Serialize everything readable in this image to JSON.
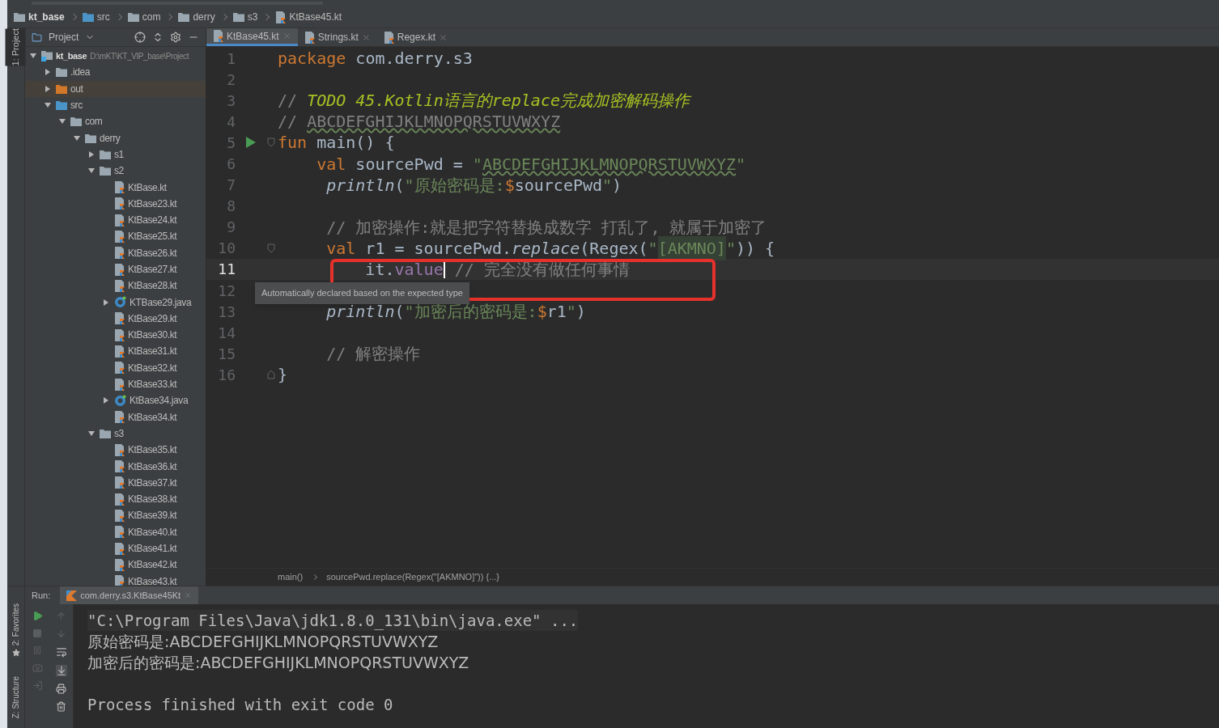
{
  "navbar": {
    "crumbs": [
      "kt_base",
      "src",
      "com",
      "derry",
      "s3",
      "KtBase45.kt"
    ]
  },
  "project_panel": {
    "title": "Project",
    "tool_tabs": [
      "1: Project"
    ]
  },
  "editor_tabs": [
    {
      "label": "KtBase45.kt",
      "selected": true
    },
    {
      "label": "Strings.kt",
      "selected": false
    },
    {
      "label": "Regex.kt",
      "selected": false
    }
  ],
  "tree": [
    {
      "label": "kt_base",
      "kind": "module",
      "path": "D:\\mKT\\KT_VIP_base\\Project",
      "expanded": true,
      "children": [
        {
          "label": ".idea",
          "kind": "folder",
          "expanded": false
        },
        {
          "label": "out",
          "kind": "excluded",
          "expanded": false
        },
        {
          "label": "src",
          "kind": "source",
          "expanded": true,
          "children": [
            {
              "label": "com",
              "kind": "package",
              "expanded": true,
              "children": [
                {
                  "label": "derry",
                  "kind": "package",
                  "expanded": true,
                  "children": [
                    {
                      "label": "s1",
                      "kind": "package",
                      "expanded": false
                    },
                    {
                      "label": "s2",
                      "kind": "package",
                      "expanded": true,
                      "children": [
                        {
                          "label": "KtBase.kt",
                          "kind": "kotlin"
                        },
                        {
                          "label": "KtBase23.kt",
                          "kind": "kotlin"
                        },
                        {
                          "label": "KtBase24.kt",
                          "kind": "kotlin"
                        },
                        {
                          "label": "KtBase25.kt",
                          "kind": "kotlin"
                        },
                        {
                          "label": "KtBase26.kt",
                          "kind": "kotlin"
                        },
                        {
                          "label": "KtBase27.kt",
                          "kind": "kotlin"
                        },
                        {
                          "label": "KtBase28.kt",
                          "kind": "kotlin"
                        },
                        {
                          "label": "KTBase29.java",
                          "kind": "java",
                          "expanded": false
                        },
                        {
                          "label": "KtBase29.kt",
                          "kind": "kotlin"
                        },
                        {
                          "label": "KtBase30.kt",
                          "kind": "kotlin"
                        },
                        {
                          "label": "KtBase31.kt",
                          "kind": "kotlin"
                        },
                        {
                          "label": "KtBase32.kt",
                          "kind": "kotlin"
                        },
                        {
                          "label": "KtBase33.kt",
                          "kind": "kotlin"
                        },
                        {
                          "label": "KtBase34.java",
                          "kind": "java",
                          "expanded": false
                        },
                        {
                          "label": "KtBase34.kt",
                          "kind": "kotlin"
                        }
                      ]
                    },
                    {
                      "label": "s3",
                      "kind": "package",
                      "expanded": true,
                      "children": [
                        {
                          "label": "KtBase35.kt",
                          "kind": "kotlin"
                        },
                        {
                          "label": "KtBase36.kt",
                          "kind": "kotlin"
                        },
                        {
                          "label": "KtBase37.kt",
                          "kind": "kotlin"
                        },
                        {
                          "label": "KtBase38.kt",
                          "kind": "kotlin"
                        },
                        {
                          "label": "KtBase39.kt",
                          "kind": "kotlin"
                        },
                        {
                          "label": "KtBase40.kt",
                          "kind": "kotlin"
                        },
                        {
                          "label": "KtBase41.kt",
                          "kind": "kotlin"
                        },
                        {
                          "label": "KtBase42.kt",
                          "kind": "kotlin"
                        },
                        {
                          "label": "KtBase43.kt",
                          "kind": "kotlin"
                        }
                      ]
                    }
                  ]
                }
              ]
            }
          ]
        }
      ]
    }
  ],
  "code_lines": [
    {
      "number": "1",
      "current": false,
      "tokens": [
        {
          "kind": "keyword",
          "text": "package"
        },
        {
          "kind": "text",
          "text": " com.derry.s3"
        }
      ]
    },
    {
      "number": "2",
      "current": false
    },
    {
      "number": "3",
      "current": false,
      "tokens": [
        {
          "kind": "comment",
          "text": "// "
        },
        {
          "kind": "todo",
          "text": "TODO 45.Kotlin语言的replace完成加密解码操作"
        }
      ]
    },
    {
      "number": "4",
      "current": false,
      "tokens": [
        {
          "kind": "comment",
          "text": "// "
        },
        {
          "kind": "comment_spell",
          "text": "ABCDEFGHIJKLMNOPQRSTUVWXYZ"
        }
      ]
    },
    {
      "number": "5",
      "current": false,
      "kind": "run_fold",
      "tokens": [
        {
          "kind": "keyword",
          "text": "fun"
        },
        {
          "kind": "text",
          "text": " main() {"
        }
      ]
    },
    {
      "number": "6",
      "current": false,
      "tokens": [
        {
          "kind": "keyword",
          "text": "    val"
        },
        {
          "kind": "text",
          "text": " sourcePwd = "
        },
        {
          "kind": "string",
          "text": "\""
        },
        {
          "kind": "string_spell",
          "text": "ABCDEFGHIJKLMNOPQRSTUVWXYZ"
        },
        {
          "kind": "string",
          "text": "\""
        }
      ]
    },
    {
      "number": "7",
      "current": false,
      "tokens": [
        {
          "kind": "call",
          "text": "     println"
        },
        {
          "kind": "text",
          "text": "("
        },
        {
          "kind": "string",
          "text": "\"原始密码是:"
        },
        {
          "kind": "template",
          "text": "$"
        },
        {
          "kind": "text",
          "text": "sourcePwd"
        },
        {
          "kind": "string",
          "text": "\""
        },
        {
          "kind": "text",
          "text": ")"
        }
      ]
    },
    {
      "number": "8",
      "current": false
    },
    {
      "number": "9",
      "current": false,
      "tokens": [
        {
          "kind": "comment",
          "text": "     // 加密操作:就是把字符替换成数字 打乱了, 就属于加密了"
        }
      ]
    },
    {
      "number": "10",
      "current": false,
      "kind": "fold",
      "tokens": [
        {
          "kind": "keyword",
          "text": "     val"
        },
        {
          "kind": "text",
          "text": " r1 = sourcePwd."
        },
        {
          "kind": "call",
          "text": "replace"
        },
        {
          "kind": "text",
          "text": "(Regex("
        },
        {
          "kind": "string",
          "text": "\""
        },
        {
          "kind": "regex",
          "text": "[AKMNO]"
        },
        {
          "kind": "string",
          "text": "\""
        },
        {
          "kind": "text",
          "text": ")) {"
        }
      ]
    },
    {
      "number": "11",
      "current": true,
      "tokens": [
        {
          "kind": "text",
          "text": "         it."
        },
        {
          "kind": "property",
          "text": "value"
        },
        {
          "kind": "caret"
        },
        {
          "kind": "comment",
          "text": " // 完全没有做任何事情"
        }
      ]
    },
    {
      "number": "12",
      "current": false
    },
    {
      "number": "13",
      "current": false,
      "tokens": [
        {
          "kind": "call",
          "text": "     println"
        },
        {
          "kind": "text",
          "text": "("
        },
        {
          "kind": "string",
          "text": "\"加密后的密码是:"
        },
        {
          "kind": "template",
          "text": "$"
        },
        {
          "kind": "text",
          "text": "r1"
        },
        {
          "kind": "string",
          "text": "\""
        },
        {
          "kind": "text",
          "text": ")"
        }
      ]
    },
    {
      "number": "14",
      "current": false
    },
    {
      "number": "15",
      "current": false,
      "tokens": [
        {
          "kind": "comment",
          "text": "     // 解密操作"
        }
      ]
    },
    {
      "number": "16",
      "current": false,
      "kind": "fold_end",
      "tokens": [
        {
          "kind": "text",
          "text": "}"
        }
      ]
    }
  ],
  "tooltip": "Automatically declared based on the expected type",
  "editor_breadcrumbs": [
    "main()",
    "sourcePwd.replace(Regex(\"[AKMNO]\")) {...}"
  ],
  "run_panel": {
    "label": "Run:",
    "tab": "com.derry.s3.KtBase45Kt",
    "side_tabs": [
      "2: Favorites",
      "Z: Structure"
    ],
    "output": [
      {
        "kind": "command",
        "text": "\"C:\\Program Files\\Java\\jdk1.8.0_131\\bin\\java.exe\" ..."
      },
      {
        "kind": "out",
        "text": "原始密码是:ABCDEFGHIJKLMNOPQRSTUVWXYZ"
      },
      {
        "kind": "out",
        "text": "加密后的密码是:ABCDEFGHIJKLMNOPQRSTUVWXYZ"
      },
      {
        "kind": "exit",
        "text": "Process finished with exit code 0"
      }
    ]
  }
}
